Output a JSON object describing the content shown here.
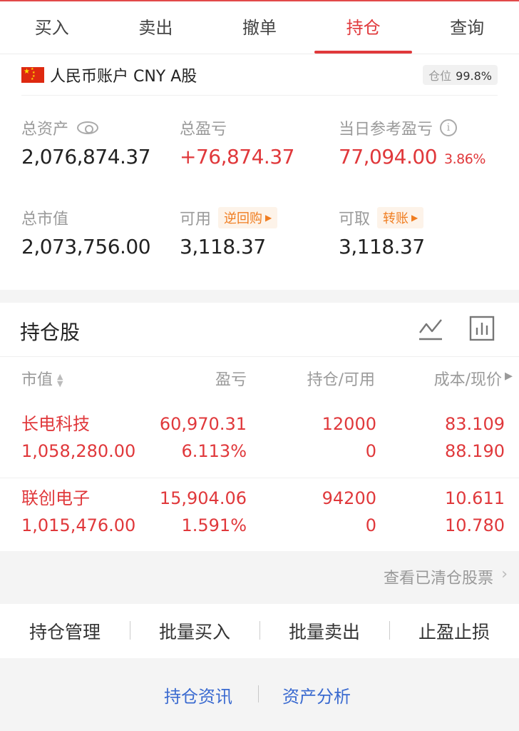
{
  "tabs": [
    {
      "label": "买入"
    },
    {
      "label": "卖出"
    },
    {
      "label": "撤单"
    },
    {
      "label": "持仓",
      "active": true
    },
    {
      "label": "查询"
    }
  ],
  "account": {
    "name": "人民币账户 CNY A股",
    "position_label": "仓位",
    "position_value": "99.8%",
    "total_assets_label": "总资产",
    "total_assets": "2,076,874.37",
    "total_pnl_label": "总盈亏",
    "total_pnl": "+76,874.37",
    "daily_pnl_label": "当日参考盈亏",
    "daily_pnl": "77,094.00",
    "daily_pnl_pct": "3.86%",
    "market_value_label": "总市值",
    "market_value": "2,073,756.00",
    "available_label": "可用",
    "available": "3,118.37",
    "repo_label": "逆回购",
    "withdrawable_label": "可取",
    "withdrawable": "3,118.37",
    "transfer_label": "转账"
  },
  "holdings": {
    "title": "持仓股",
    "columns": [
      "市值",
      "盈亏",
      "持仓/可用",
      "成本/现价"
    ],
    "rows": [
      {
        "name": "长电科技",
        "market_value": "1,058,280.00",
        "pnl": "60,970.31",
        "pnl_pct": "6.113%",
        "position": "12000",
        "available": "0",
        "cost": "83.109",
        "price": "88.190"
      },
      {
        "name": "联创电子",
        "market_value": "1,015,476.00",
        "pnl": "15,904.06",
        "pnl_pct": "1.591%",
        "position": "94200",
        "available": "0",
        "cost": "10.611",
        "price": "10.780"
      }
    ]
  },
  "cleared_link": "查看已清仓股票",
  "actions": [
    "持仓管理",
    "批量买入",
    "批量卖出",
    "止盈止损"
  ],
  "links": [
    "持仓资讯",
    "资产分析"
  ],
  "colors": {
    "accent": "#e0383b",
    "orange": "#f07d20",
    "link": "#3a6ad0"
  }
}
